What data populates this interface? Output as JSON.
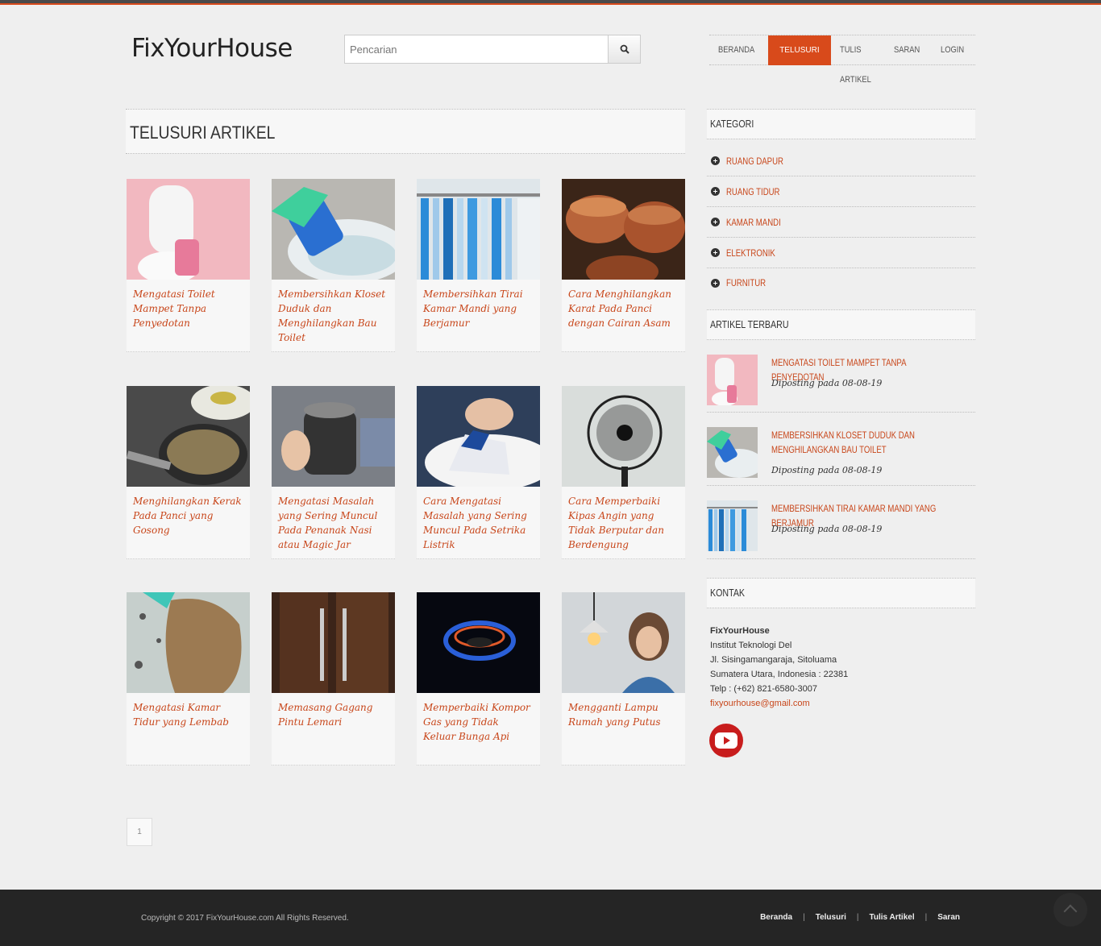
{
  "header": {
    "logo": "FixYourHouse",
    "search_placeholder": "Pencarian",
    "nav": [
      "BERANDA",
      "TELUSURI",
      "TULIS ARTIKEL",
      "SARAN",
      "LOGIN"
    ],
    "nav_active": "TELUSURI"
  },
  "main": {
    "title": "TELUSURI ARTIKEL",
    "articles": [
      "Mengatasi Toilet Mampet Tanpa Penyedotan",
      "Membersihkan Kloset Duduk dan Menghilangkan Bau Toilet",
      "Membersihkan Tirai Kamar Mandi yang Berjamur",
      "Cara Menghilangkan Karat Pada Panci dengan Cairan Asam",
      "Menghilangkan Kerak Pada Panci yang Gosong",
      "Mengatasi Masalah yang Sering Muncul Pada Penanak Nasi atau Magic Jar",
      "Cara Mengatasi Masalah yang Sering Muncul Pada Setrika Listrik",
      "Cara Memperbaiki Kipas Angin yang Tidak Berputar dan Berdengung",
      "Mengatasi Kamar Tidur yang Lembab",
      "Memasang Gagang Pintu Lemari",
      "Memperbaiki Kompor Gas yang Tidak Keluar Bunga Api",
      "Mengganti Lampu Rumah yang Putus"
    ],
    "page": "1"
  },
  "sidebar": {
    "kategori_title": "KATEGORI",
    "categories": [
      "RUANG DAPUR",
      "RUANG TIDUR",
      "KAMAR MANDI",
      "ELEKTRONIK",
      "FURNITUR"
    ],
    "recent_title": "ARTIKEL TERBARU",
    "recent": [
      {
        "title": "MENGATASI TOILET MAMPET TANPA PENYEDOTAN",
        "date": "Diposting pada 08-08-19"
      },
      {
        "title": "MEMBERSIHKAN KLOSET DUDUK DAN MENGHILANGKAN BAU TOILET",
        "date": "Diposting pada 08-08-19"
      },
      {
        "title": "MEMBERSIHKAN TIRAI KAMAR MANDI YANG BERJAMUR",
        "date": "Diposting pada 08-08-19"
      }
    ],
    "contact_title": "KONTAK",
    "contact": {
      "name": "FixYourHouse",
      "line1": "Institut Teknologi Del",
      "line2": "Jl. Sisingamangaraja, Sitoluama",
      "line3": "Sumatera Utara, Indonesia : 22381",
      "phone": "Telp : (+62) 821-6580-3007",
      "email": "fixyourhouse@gmail.com"
    }
  },
  "footer": {
    "copyright": "Copyright © 2017 FixYourHouse.com All Rights Reserved.",
    "links": [
      "Beranda",
      "Telusuri",
      "Tulis Artikel",
      "Saran"
    ]
  },
  "colors": {
    "accent": "#d84a1b",
    "link": "#c8461a",
    "footer": "#252525"
  }
}
